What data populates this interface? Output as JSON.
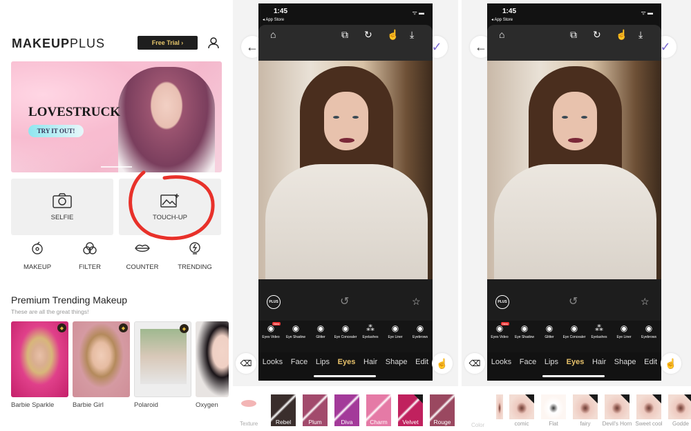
{
  "left": {
    "logo": {
      "bold": "MAKEUP",
      "light": "PLUS"
    },
    "free_trial": "Free Trial ›",
    "banner": {
      "title": "LOVESTRUCK",
      "cta": "TRY IT OUT!"
    },
    "cards": [
      {
        "label": "SELFIE",
        "icon": "camera-icon"
      },
      {
        "label": "TOUCH-UP",
        "icon": "image-edit-icon"
      }
    ],
    "quick": [
      {
        "label": "MAKEUP",
        "icon": "makeup-icon"
      },
      {
        "label": "FILTER",
        "icon": "filter-icon"
      },
      {
        "label": "COUNTER",
        "icon": "lips-icon"
      },
      {
        "label": "TRENDING",
        "icon": "trending-icon"
      }
    ],
    "section": {
      "title": "Premium Trending Makeup",
      "subtitle": "These are all the great things!"
    },
    "looks": [
      {
        "label": "Barbie Sparkle",
        "premium": true
      },
      {
        "label": "Barbie Girl",
        "premium": true
      },
      {
        "label": "Polaroid",
        "premium": true
      },
      {
        "label": "Oxygen",
        "premium": false
      }
    ],
    "annotation_color": "#e8312a"
  },
  "editor": {
    "time": "1:45",
    "back_app": "◂ App Store",
    "feature_items": [
      {
        "label": "Eyes Video",
        "badge": "New"
      },
      {
        "label": "Eye Shadow"
      },
      {
        "label": "Glitter"
      },
      {
        "label": "Eye Concealer"
      },
      {
        "label": "Eyelashes"
      },
      {
        "label": "Eye Liner"
      },
      {
        "label": "Eyebrows"
      }
    ],
    "tabs": [
      "Looks",
      "Face",
      "Lips",
      "Eyes",
      "Hair",
      "Shape",
      "Edit"
    ],
    "active_tab": "Eyes",
    "plus_label": "PLUS",
    "accent": "#e8c26b"
  },
  "middle": {
    "texture_label": "Texture",
    "swatches": [
      {
        "label": "Rebel",
        "color": "#3a2e2c"
      },
      {
        "label": "Plum",
        "color": "#a24a6c"
      },
      {
        "label": "Diva",
        "color": "#a33a9a"
      },
      {
        "label": "Charm",
        "color": "#e57aa6"
      },
      {
        "label": "Velvet",
        "color": "#c0215e",
        "premium": true
      },
      {
        "label": "Rouge",
        "color": "#9a4860"
      }
    ]
  },
  "right": {
    "color_label": "Color",
    "styles": [
      {
        "label": "comic",
        "premium": true
      },
      {
        "label": "Flat",
        "premium": false
      },
      {
        "label": "fairy",
        "premium": true
      },
      {
        "label": "Devil's Horn",
        "premium": true
      },
      {
        "label": "Sweet cool",
        "premium": true
      },
      {
        "label": "Godde",
        "premium": true
      }
    ]
  }
}
